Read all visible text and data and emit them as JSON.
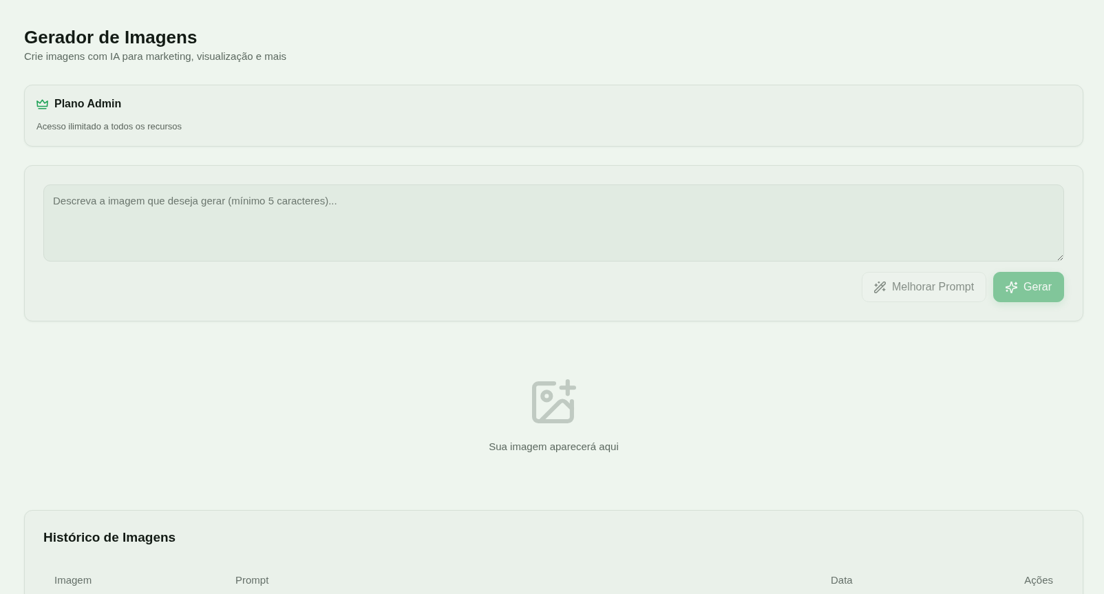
{
  "header": {
    "title": "Gerador de Imagens",
    "subtitle": "Crie imagens com IA para marketing, visualização e mais"
  },
  "plan": {
    "name": "Plano Admin",
    "description": "Acesso ilimitado a todos os recursos"
  },
  "prompt": {
    "placeholder": "Descreva a imagem que deseja gerar (mínimo 5 caracteres)...",
    "buttons": [
      {
        "kind": "improve",
        "label": "Melhorar Prompt",
        "disabled": true
      },
      {
        "kind": "generate",
        "label": "Gerar",
        "disabled": true
      }
    ]
  },
  "preview": {
    "text": "Sua imagem aparecerá aqui"
  },
  "history": {
    "title": "Histórico de Imagens",
    "columns": [
      "Imagem",
      "Prompt",
      "Data",
      "Ações"
    ]
  }
}
